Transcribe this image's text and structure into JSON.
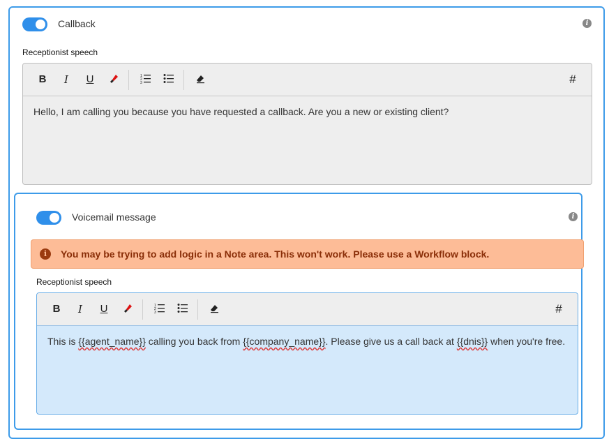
{
  "callback": {
    "title": "Callback",
    "enabled": true,
    "field_label": "Receptionist speech",
    "text": "Hello, I am calling you because you have requested a callback. Are you a new or existing client?"
  },
  "voicemail": {
    "title": "Voicemail message",
    "enabled": true,
    "warning": "You may be trying to add logic in a Note area. This won't work. Please use a Workflow block.",
    "field_label": "Receptionist speech",
    "text_parts": {
      "p1": "This is ",
      "var1": "{{agent_name}}",
      "p2": " calling you back from ",
      "var2": "{{company_name}}",
      "p3": ". Please give us a call back at ",
      "var3": "{{dnis}}",
      "p4": " when you're free."
    }
  },
  "toolbar": {
    "bold": "B",
    "italic": "I",
    "underline": "U",
    "variable": "#"
  },
  "colors": {
    "accent": "#2f8fea",
    "warning_bg": "#fdbc97",
    "warning_text": "#8a2e08",
    "editor_active_bg": "#d4e9fb"
  }
}
